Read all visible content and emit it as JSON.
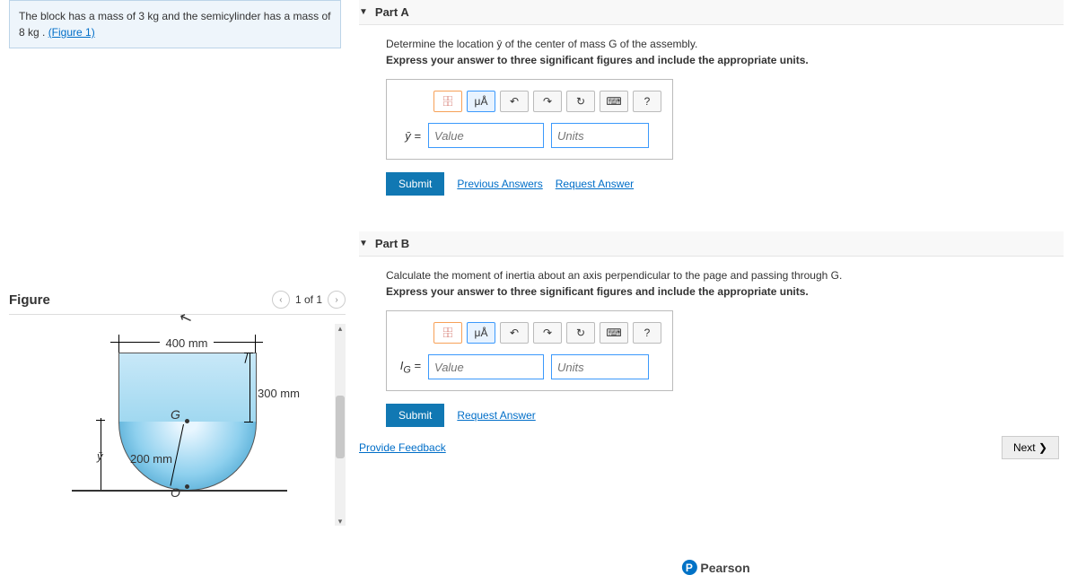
{
  "problem": {
    "text_1": "The block has a mass of 3  kg and the semicylinder has a mass of",
    "text_2": "8  kg . ",
    "figure_link": "(Figure 1)"
  },
  "figure": {
    "title": "Figure",
    "pager": "1 of 1",
    "dim_top": "400 mm",
    "dim_right": "300 mm",
    "dim_radius": "200 mm",
    "g_label": "G",
    "o_label": "O",
    "ybar": "ȳ"
  },
  "partA": {
    "title": "Part A",
    "instruction": "Determine the location ȳ of the center of mass G of the assembly.",
    "sub": "Express your answer to three significant figures and include the appropriate units.",
    "eq_label": "ȳ =",
    "value_ph": "Value",
    "units_ph": "Units",
    "submit": "Submit",
    "prev": "Previous Answers",
    "req": "Request Answer"
  },
  "partB": {
    "title": "Part B",
    "instruction": "Calculate the moment of inertia about an axis perpendicular to the page and passing through G.",
    "sub": "Express your answer to three significant figures and include the appropriate units.",
    "eq_label": "I_G =",
    "value_ph": "Value",
    "units_ph": "Units",
    "submit": "Submit",
    "req": "Request Answer"
  },
  "toolbar": {
    "templates": "□",
    "mu": "μÅ",
    "undo": "↶",
    "redo": "↷",
    "reset": "↻",
    "keyboard": "⌨",
    "help": "?"
  },
  "footer": {
    "feedback": "Provide Feedback",
    "next": "Next ❯",
    "brand": "Pearson"
  }
}
